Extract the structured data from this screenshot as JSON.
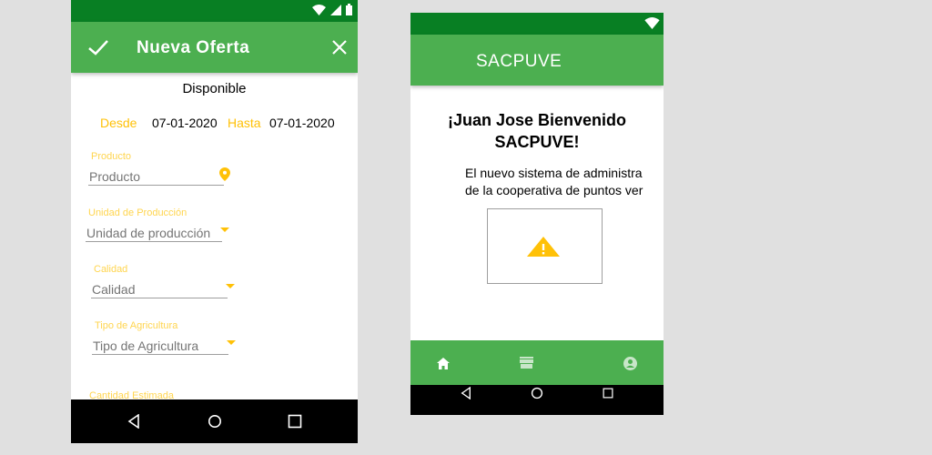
{
  "offer_screen": {
    "appbar": {
      "title": "Nueva Oferta"
    },
    "availability_heading": "Disponible",
    "date_range": {
      "from_label": "Desde",
      "from_value": "07-01-2020",
      "to_label": "Hasta",
      "to_value": "07-01-2020"
    },
    "fields": [
      {
        "label": "Producto",
        "value": "Producto",
        "icon": "location-pin-icon"
      },
      {
        "label": "Unidad de Producción",
        "value": "Unidad de producción"
      },
      {
        "label": "Calidad",
        "value": "Calidad"
      },
      {
        "label": "Tipo de Agricultura",
        "value": "Tipo de Agricultura"
      },
      {
        "label": "Cantidad Estimada"
      }
    ]
  },
  "home_screen": {
    "appbar": {
      "title": "SACPUVE"
    },
    "welcome_line1": "¡Juan Jose Bienvenido",
    "welcome_line2": "SACPUVE!",
    "description_line1": "El nuevo sistema de administra",
    "description_line2": "de la cooperativa de puntos ver",
    "image_placeholder_icon": "warning-icon",
    "bottom_nav": [
      "home-icon",
      "store-icon",
      "account-icon"
    ]
  },
  "colors": {
    "primary": "#4caf50",
    "primary_dark": "#087f23",
    "accent": "#ffc107"
  }
}
